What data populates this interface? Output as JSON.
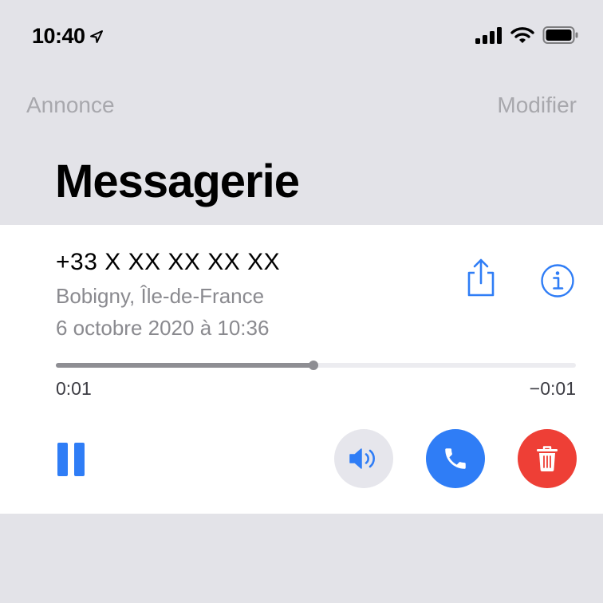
{
  "status_bar": {
    "time": "10:40",
    "icons": [
      "location-arrow-icon",
      "cellular-signal-icon",
      "wifi-icon",
      "battery-icon"
    ]
  },
  "nav": {
    "left_label": "Annonce",
    "right_label": "Modifier"
  },
  "title": "Messagerie",
  "voicemail": {
    "caller": "+33 X XX XX XX XX",
    "location": "Bobigny, Île-de-France",
    "datetime": "6 octobre 2020 à 10:36",
    "elapsed": "0:01",
    "remaining": "−0:01",
    "progress_fraction": 0.495,
    "actions": [
      "share-icon",
      "info-icon",
      "pause-icon",
      "speaker-icon",
      "phone-icon",
      "trash-icon"
    ]
  },
  "colors": {
    "accent": "#2f7df6",
    "delete": "#ee3f36",
    "speaker_bg": "#e6e6ec",
    "background": "#e3e3e8"
  }
}
